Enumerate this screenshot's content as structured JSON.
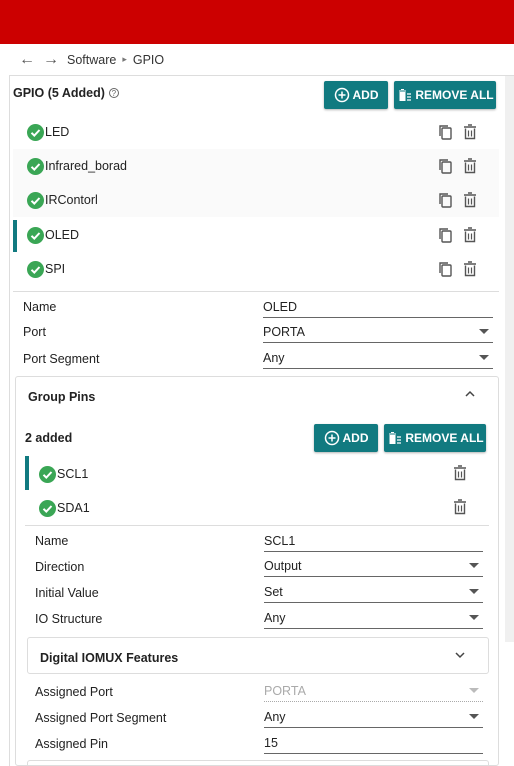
{
  "breadcrumb": {
    "back": "←",
    "forward": "→",
    "items": [
      "Software",
      "GPIO"
    ],
    "separator": "▸"
  },
  "gpio": {
    "title": "GPIO (5 Added)",
    "help": "?",
    "add_label": "ADD",
    "remove_all_label": "REMOVE ALL",
    "items": [
      {
        "label": "LED"
      },
      {
        "label": "Infrared_borad"
      },
      {
        "label": "IRContorl"
      },
      {
        "label": "OLED"
      },
      {
        "label": "SPI"
      }
    ]
  },
  "details": {
    "name_label": "Name",
    "name_value": "OLED",
    "port_label": "Port",
    "port_value": "PORTA",
    "segment_label": "Port Segment",
    "segment_value": "Any"
  },
  "group_pins": {
    "title": "Group Pins",
    "count": "2 added",
    "add_label": "ADD",
    "remove_all_label": "REMOVE ALL",
    "items": [
      {
        "label": "SCL1"
      },
      {
        "label": "SDA1"
      }
    ],
    "name_label": "Name",
    "name_value": "SCL1",
    "direction_label": "Direction",
    "direction_value": "Output",
    "initial_label": "Initial Value",
    "initial_value": "Set",
    "io_label": "IO Structure",
    "io_value": "Any"
  },
  "iomux": {
    "title": "Digital IOMUX Features",
    "port_label": "Assigned Port",
    "port_value": "PORTA",
    "segment_label": "Assigned Port Segment",
    "segment_value": "Any",
    "pin_label": "Assigned Pin",
    "pin_value": "15"
  },
  "colors": {
    "topbar": "#cc0000",
    "accent": "#117a80",
    "check": "#3aa655"
  }
}
